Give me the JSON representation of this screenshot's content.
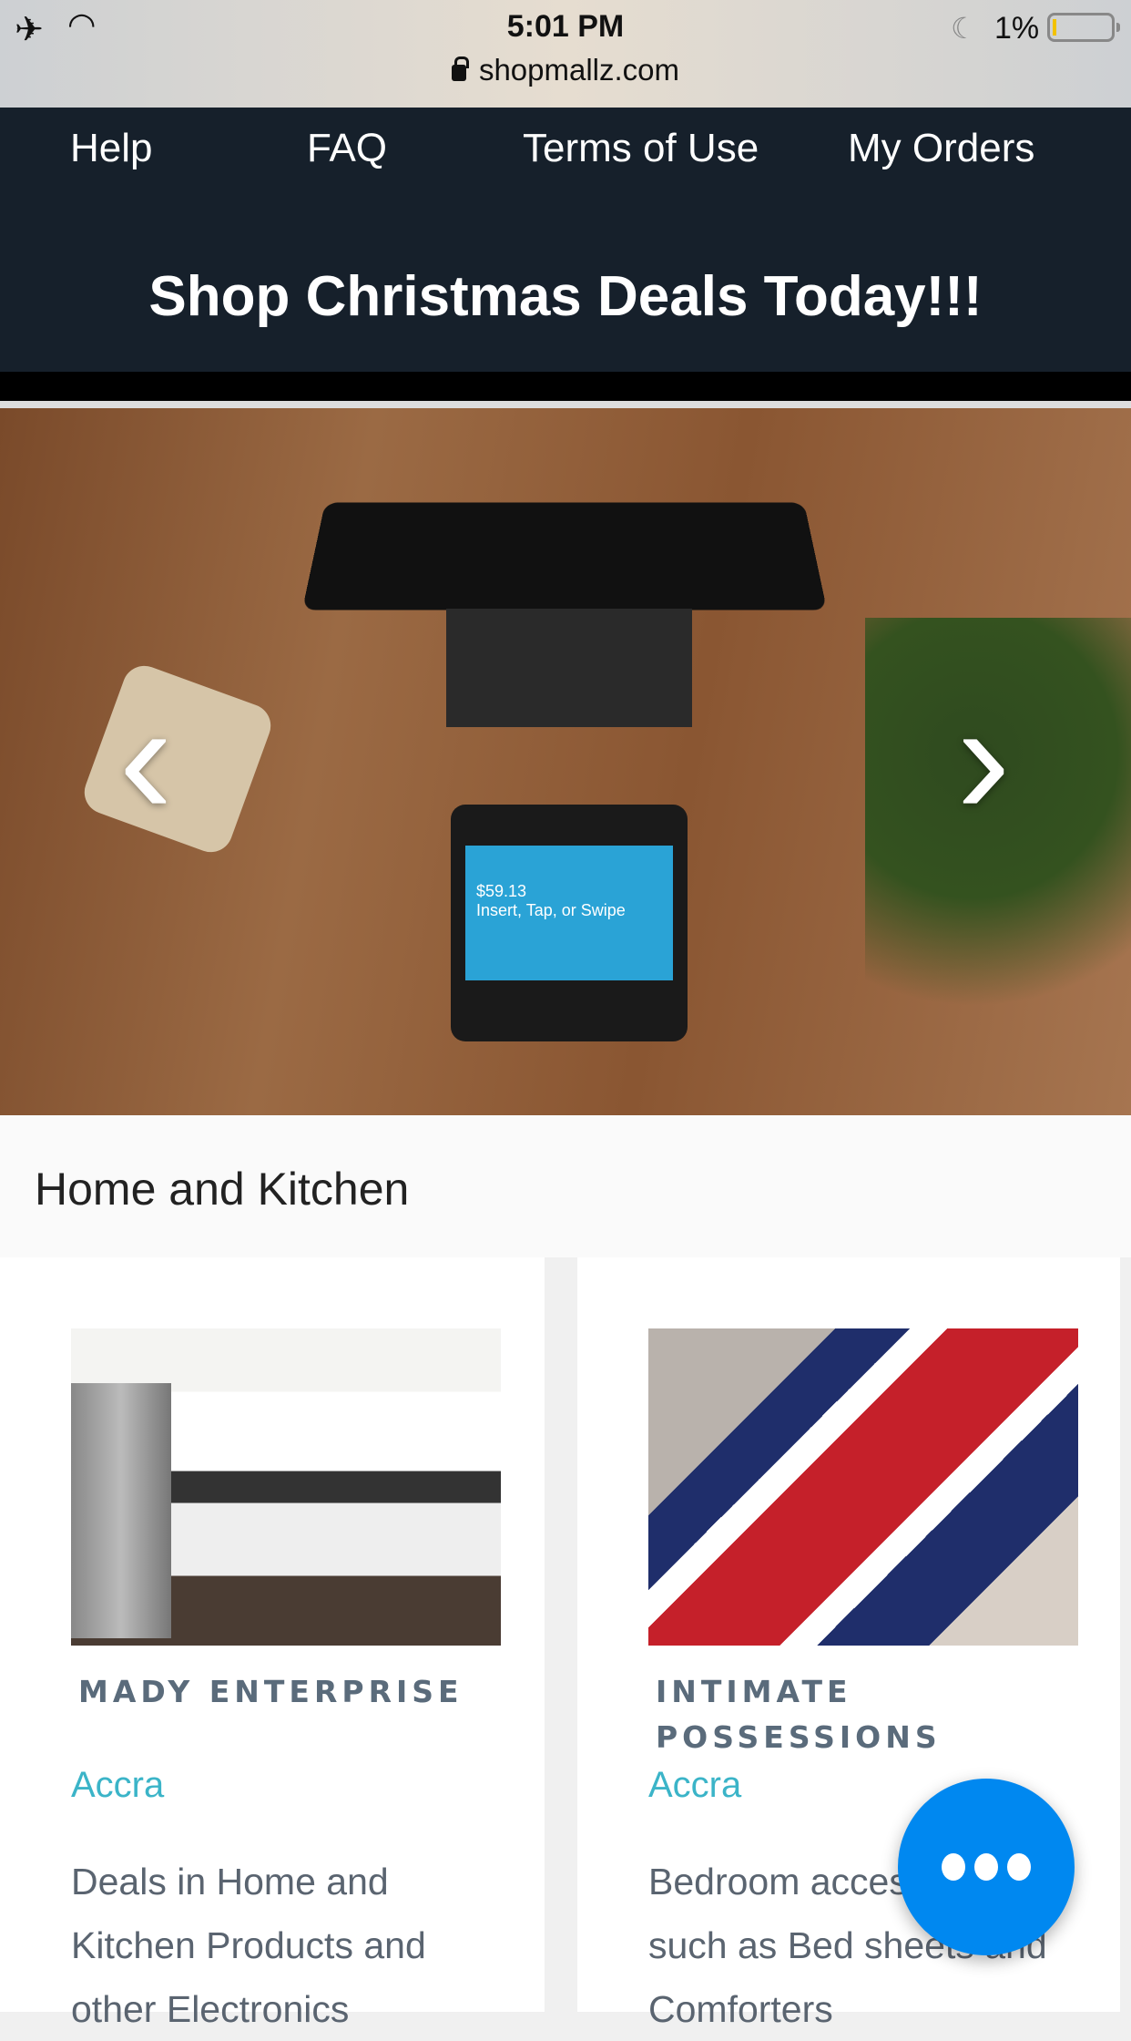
{
  "status_bar": {
    "time": "5:01 PM",
    "battery": "1%",
    "url": "shopmallz.com",
    "icons": [
      "airplane-icon",
      "wifi-icon",
      "moon-icon",
      "battery-icon",
      "lock-icon"
    ]
  },
  "nav": {
    "items": [
      {
        "label": "Help"
      },
      {
        "label": "FAQ"
      },
      {
        "label": "Terms of Use"
      },
      {
        "label": "My Orders"
      }
    ],
    "promo": "Shop Christmas Deals Today!!!"
  },
  "hero": {
    "reader_amount": "$59.13",
    "reader_prompt": "Insert, Tap, or Swipe",
    "prev_icon": "chevron-left-icon",
    "next_icon": "chevron-right-icon"
  },
  "section": {
    "title": "Home and Kitchen"
  },
  "cards": [
    {
      "name": "MADY ENTERPRISE",
      "city": "Accra",
      "description": "Deals in Home and Kitchen Products and other Electronics"
    },
    {
      "name": "INTIMATE POSSESSIONS",
      "city": "Accra",
      "description": "Bedroom accessories such as Bed sheets and Comforters"
    }
  ],
  "colors": {
    "nav_bg": "#16202b",
    "accent": "#3bb4c8",
    "fab": "#0088f0"
  },
  "fab": {
    "icon": "more-horizontal-icon"
  }
}
